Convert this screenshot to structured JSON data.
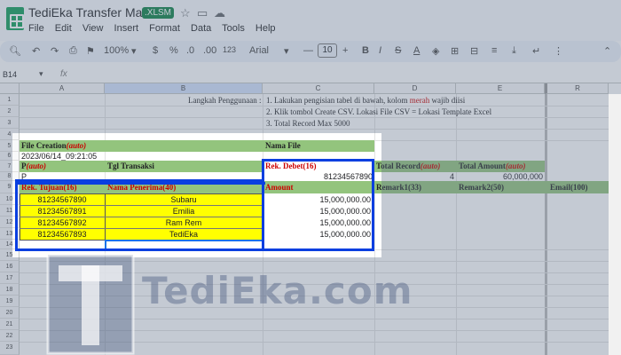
{
  "window": {
    "title": "TediEka Transfer Massal",
    "ext_badge": ".XLSM"
  },
  "menu": [
    "File",
    "Edit",
    "View",
    "Insert",
    "Format",
    "Data",
    "Tools",
    "Help"
  ],
  "toolbar": {
    "zoom": "100%",
    "currency": "$",
    "percent": "%",
    "dec_dec": ".0",
    "dec_inc": ".00",
    "number_format": "123",
    "font": "Arial",
    "font_size": "10",
    "minus": "—",
    "plus": "+"
  },
  "formula_bar": {
    "cell_ref": "B14",
    "fx": "fx",
    "value": ""
  },
  "columns": [
    "A",
    "B",
    "C",
    "D",
    "E",
    "R"
  ],
  "rows": [
    "1",
    "2",
    "3",
    "4",
    "5",
    "6",
    "7",
    "8",
    "9",
    "10",
    "11",
    "12",
    "13",
    "14",
    "15",
    "16",
    "17",
    "18",
    "19",
    "20",
    "21",
    "22",
    "23"
  ],
  "sheet": {
    "instructions_label": "Langkah Penggunaan :",
    "instruction_1a": "1. Lakukan pengisian tabel di bawah, kolom",
    "instruction_1_red": "merah",
    "instruction_1b": "wajib diisi",
    "instruction_2": "2. Klik tombol Create CSV. Lokasi File CSV = Lokasi Template Excel",
    "instruction_3": "3. Total Record Max 5000",
    "file_creation_label": "File Creation",
    "auto": "(auto)",
    "file_creation_value": "2023/06/14_09:21:05",
    "nama_file_label": "Nama File",
    "p_label": "P",
    "p_value": "P",
    "tgl_transaksi": "Tgl Transaksi",
    "rek_debet_label": "Rek. Debet(16)",
    "rek_debet_value": "81234567890",
    "total_record_label": "Total Record",
    "total_record_value": "4",
    "total_amount_label": "Total Amount",
    "total_amount_value": "60,000,000",
    "rek_tujuan_label": "Rek. Tujuan(16)",
    "nama_penerima_label": "Nama Penerima(40)",
    "amount_label": "Amount",
    "remark1": "Remark1(33)",
    "remark2": "Remark2(50)",
    "email": "Email(100)",
    "entries": [
      {
        "rek": "81234567890",
        "nama": "Subaru",
        "amount": "15,000,000.00"
      },
      {
        "rek": "81234567891",
        "nama": "Emilia",
        "amount": "15,000,000.00"
      },
      {
        "rek": "81234567892",
        "nama": "Ram Rem",
        "amount": "15,000,000.00"
      },
      {
        "rek": "81234567893",
        "nama": "TediEka",
        "amount": "15,000,000.00"
      }
    ]
  },
  "watermark": {
    "letter": "T",
    "text": "TediEka.com"
  },
  "colors": {
    "highlight_border": "#0a3fe0",
    "header_green": "#93c47d",
    "yellow": "#ffff00",
    "red": "#cc0000"
  }
}
